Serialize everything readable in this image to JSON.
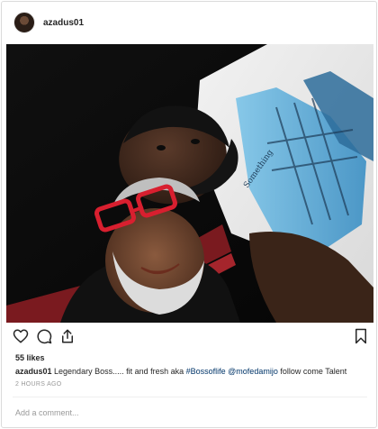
{
  "post": {
    "username": "azadus01",
    "likes": "55 likes",
    "caption": {
      "user": "azadus01",
      "text_1": " Legendary Boss..... fit and fresh aka ",
      "hashtag": "#Bossoflife",
      "text_2": " ",
      "mention": "@mofedamijo",
      "text_3": " follow come Talent"
    },
    "timestamp": "2 HOURS AGO",
    "comment_placeholder": "Add a comment..."
  },
  "photo": {
    "subject": "selfie-two-men",
    "shirt_print_text": "Something"
  },
  "icons": {
    "heart": "heart-icon",
    "comment": "comment-icon",
    "share": "share-icon",
    "save": "bookmark-icon"
  },
  "colors": {
    "text": "#262626",
    "secondary": "#999999",
    "link": "#003569",
    "border": "#dbdbdb"
  }
}
